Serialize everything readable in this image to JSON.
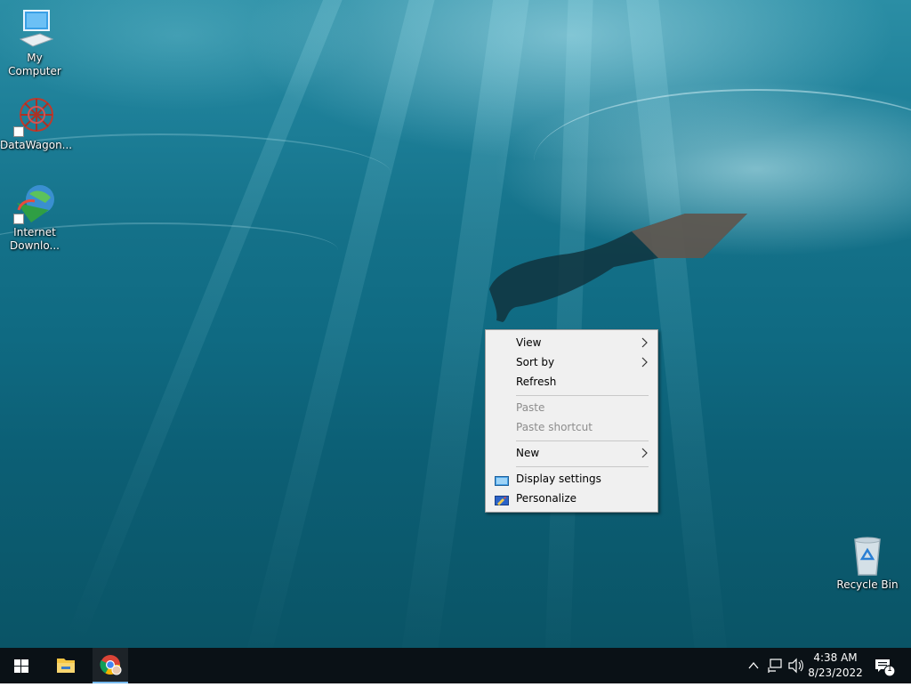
{
  "desktop": {
    "icons": [
      {
        "label": "My Computer",
        "icon": "computer-icon"
      },
      {
        "label": "DataWagon...",
        "icon": "datawagon-icon"
      },
      {
        "label": "Internet Downlo...",
        "icon": "internet-download-manager-icon"
      },
      {
        "label": "Recycle Bin",
        "icon": "recycle-bin-icon"
      }
    ]
  },
  "context_menu": {
    "items": [
      {
        "label": "View",
        "submenu": true,
        "enabled": true
      },
      {
        "label": "Sort by",
        "submenu": true,
        "enabled": true
      },
      {
        "label": "Refresh",
        "submenu": false,
        "enabled": true
      },
      {
        "label": "Paste",
        "submenu": false,
        "enabled": false
      },
      {
        "label": "Paste shortcut",
        "submenu": false,
        "enabled": false
      },
      {
        "label": "New",
        "submenu": true,
        "enabled": true
      },
      {
        "label": "Display settings",
        "submenu": false,
        "enabled": true,
        "icon": "display-icon"
      },
      {
        "label": "Personalize",
        "submenu": false,
        "enabled": true,
        "icon": "personalize-icon"
      }
    ]
  },
  "taskbar": {
    "pinned": [
      {
        "name": "start-button",
        "icon": "windows-logo-icon"
      },
      {
        "name": "file-explorer",
        "icon": "folder-icon"
      },
      {
        "name": "chrome",
        "icon": "chrome-icon",
        "active": true
      }
    ],
    "tray": {
      "time": "4:38 AM",
      "date": "8/23/2022",
      "notification_count": "1"
    }
  },
  "colors": {
    "taskbar": "#0a1116",
    "accent": "#76b9ed",
    "menu_bg": "#f0f0f0"
  }
}
